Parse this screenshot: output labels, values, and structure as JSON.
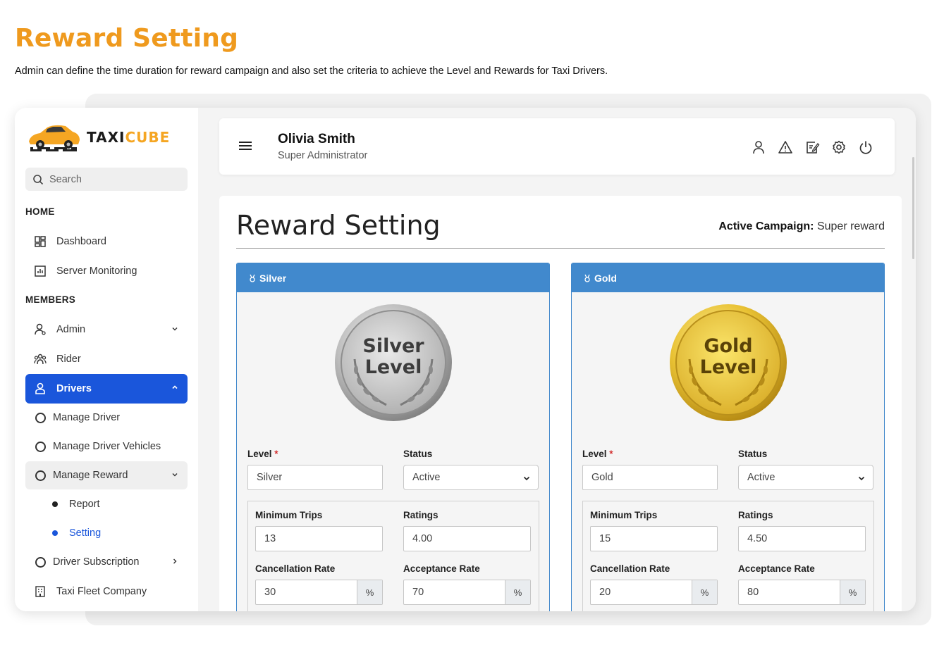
{
  "intro": {
    "title": "Reward Setting",
    "subtitle": "Admin can define the time duration for reward campaign and also set the criteria to achieve the Level and Rewards for Taxi Drivers."
  },
  "brand": {
    "name_dark": "TAXI",
    "name_accent": "CUBE",
    "accent_color": "#f5a623"
  },
  "search": {
    "placeholder": "Search"
  },
  "sidebar": {
    "sections": {
      "home": "HOME",
      "members": "MEMBERS"
    },
    "items": {
      "dashboard": "Dashboard",
      "server_monitoring": "Server Monitoring",
      "admin": "Admin",
      "rider": "Rider",
      "drivers": "Drivers",
      "manage_driver": "Manage Driver",
      "manage_driver_vehicles": "Manage Driver Vehicles",
      "manage_reward": "Manage Reward",
      "report": "Report",
      "setting": "Setting",
      "driver_subscription": "Driver Subscription",
      "taxi_fleet_company": "Taxi Fleet Company"
    },
    "active_color": "#1a56db"
  },
  "header": {
    "user_name": "Olivia Smith",
    "user_role": "Super Administrator",
    "icons": [
      "user-icon",
      "warning-icon",
      "edit-note-icon",
      "settings-icon",
      "power-icon"
    ]
  },
  "main": {
    "title": "Reward Setting",
    "campaign_label": "Active Campaign:",
    "campaign_value": "Super reward",
    "labels": {
      "level": "Level",
      "required": "*",
      "status": "Status",
      "minimum_trips": "Minimum Trips",
      "ratings": "Ratings",
      "cancellation_rate": "Cancellation Rate",
      "acceptance_rate": "Acceptance Rate",
      "percent": "%"
    },
    "panels": [
      {
        "title": "Silver",
        "medal_line1": "Silver",
        "medal_line2": "Level",
        "level": "Silver",
        "status": "Active",
        "minimum_trips": "13",
        "ratings": "4.00",
        "cancellation_rate": "30",
        "acceptance_rate": "70"
      },
      {
        "title": "Gold",
        "medal_line1": "Gold",
        "medal_line2": "Level",
        "level": "Gold",
        "status": "Active",
        "minimum_trips": "15",
        "ratings": "4.50",
        "cancellation_rate": "20",
        "acceptance_rate": "80"
      }
    ],
    "header_color": "#4189cd"
  }
}
